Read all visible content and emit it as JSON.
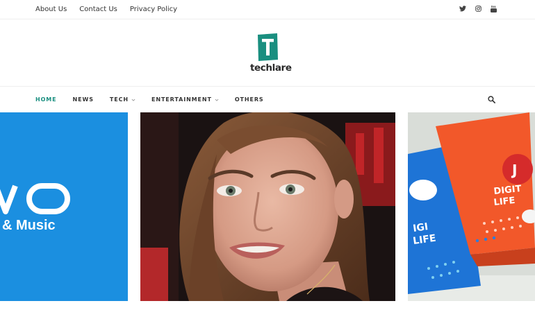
{
  "topbar": {
    "links": [
      "About Us",
      "Contact Us",
      "Privacy Policy"
    ],
    "social_icons": [
      "twitter-icon",
      "instagram-icon",
      "youtube-icon"
    ]
  },
  "logo": {
    "mark_letter": "T",
    "text": "techlare",
    "brand_color": "#1a8f80"
  },
  "nav": {
    "items": [
      {
        "label": "HOME",
        "active": true,
        "dropdown": false
      },
      {
        "label": "NEWS",
        "active": false,
        "dropdown": false
      },
      {
        "label": "TECH",
        "active": false,
        "dropdown": true
      },
      {
        "label": "ENTERTAINMENT",
        "active": false,
        "dropdown": true
      },
      {
        "label": "OTHERS",
        "active": false,
        "dropdown": false
      }
    ],
    "search_icon": "search-icon"
  },
  "slider": {
    "left_slide_text": "& Music",
    "right_slide_card_text": "DIGITAL LIFE"
  }
}
